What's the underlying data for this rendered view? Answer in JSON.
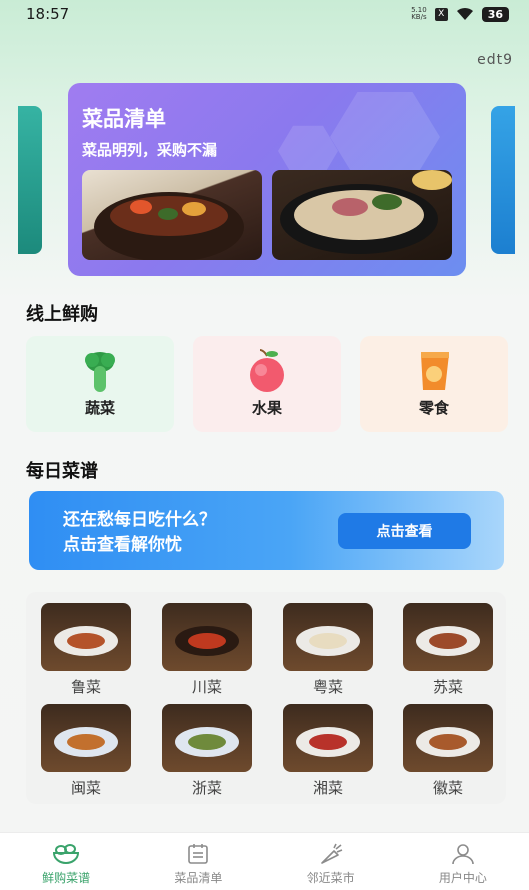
{
  "status_bar": {
    "time": "18:57",
    "speed_value": "5.10",
    "speed_unit": "KB/s",
    "x_badge": "X",
    "battery": "36"
  },
  "header": {
    "user_tag": "edt9"
  },
  "banner": {
    "title": "菜品清单",
    "subtitle": "菜品明列，采购不漏"
  },
  "online_fresh": {
    "title": "线上鲜购",
    "categories": [
      {
        "label": "蔬菜",
        "icon": "vegetable-icon",
        "bg": "#e8f6ec"
      },
      {
        "label": "水果",
        "icon": "apple-icon",
        "bg": "#fbecec"
      },
      {
        "label": "零食",
        "icon": "snack-bag-icon",
        "bg": "#fbefe6"
      }
    ]
  },
  "daily_recipe": {
    "title": "每日菜谱",
    "promo_line1": "还在愁每日吃什么？",
    "promo_line2": "点击查看解你忧",
    "promo_button": "点击查看"
  },
  "cuisines": [
    {
      "label": "鲁菜",
      "food_color": "#b4532a"
    },
    {
      "label": "川菜",
      "food_color": "#c0391f"
    },
    {
      "label": "粤菜",
      "food_color": "#e8dcc0"
    },
    {
      "label": "苏菜",
      "food_color": "#9c4a2a"
    },
    {
      "label": "闽菜",
      "food_color": "#c2702e"
    },
    {
      "label": "浙菜",
      "food_color": "#6f8a3c"
    },
    {
      "label": "湘菜",
      "food_color": "#b8322a"
    },
    {
      "label": "徽菜",
      "food_color": "#a85a2c"
    }
  ],
  "tabbar": {
    "tabs": [
      {
        "label": "鲜购菜谱",
        "icon": "salad-bowl-icon",
        "active": true
      },
      {
        "label": "菜品清单",
        "icon": "calendar-list-icon",
        "active": false
      },
      {
        "label": "邻近菜市",
        "icon": "carrot-icon",
        "active": false
      },
      {
        "label": "用户中心",
        "icon": "user-icon",
        "active": false
      }
    ]
  },
  "colors": {
    "accent_green": "#3aa36b",
    "banner_purple": "#8b79ee",
    "promo_blue": "#2f8ef3"
  }
}
